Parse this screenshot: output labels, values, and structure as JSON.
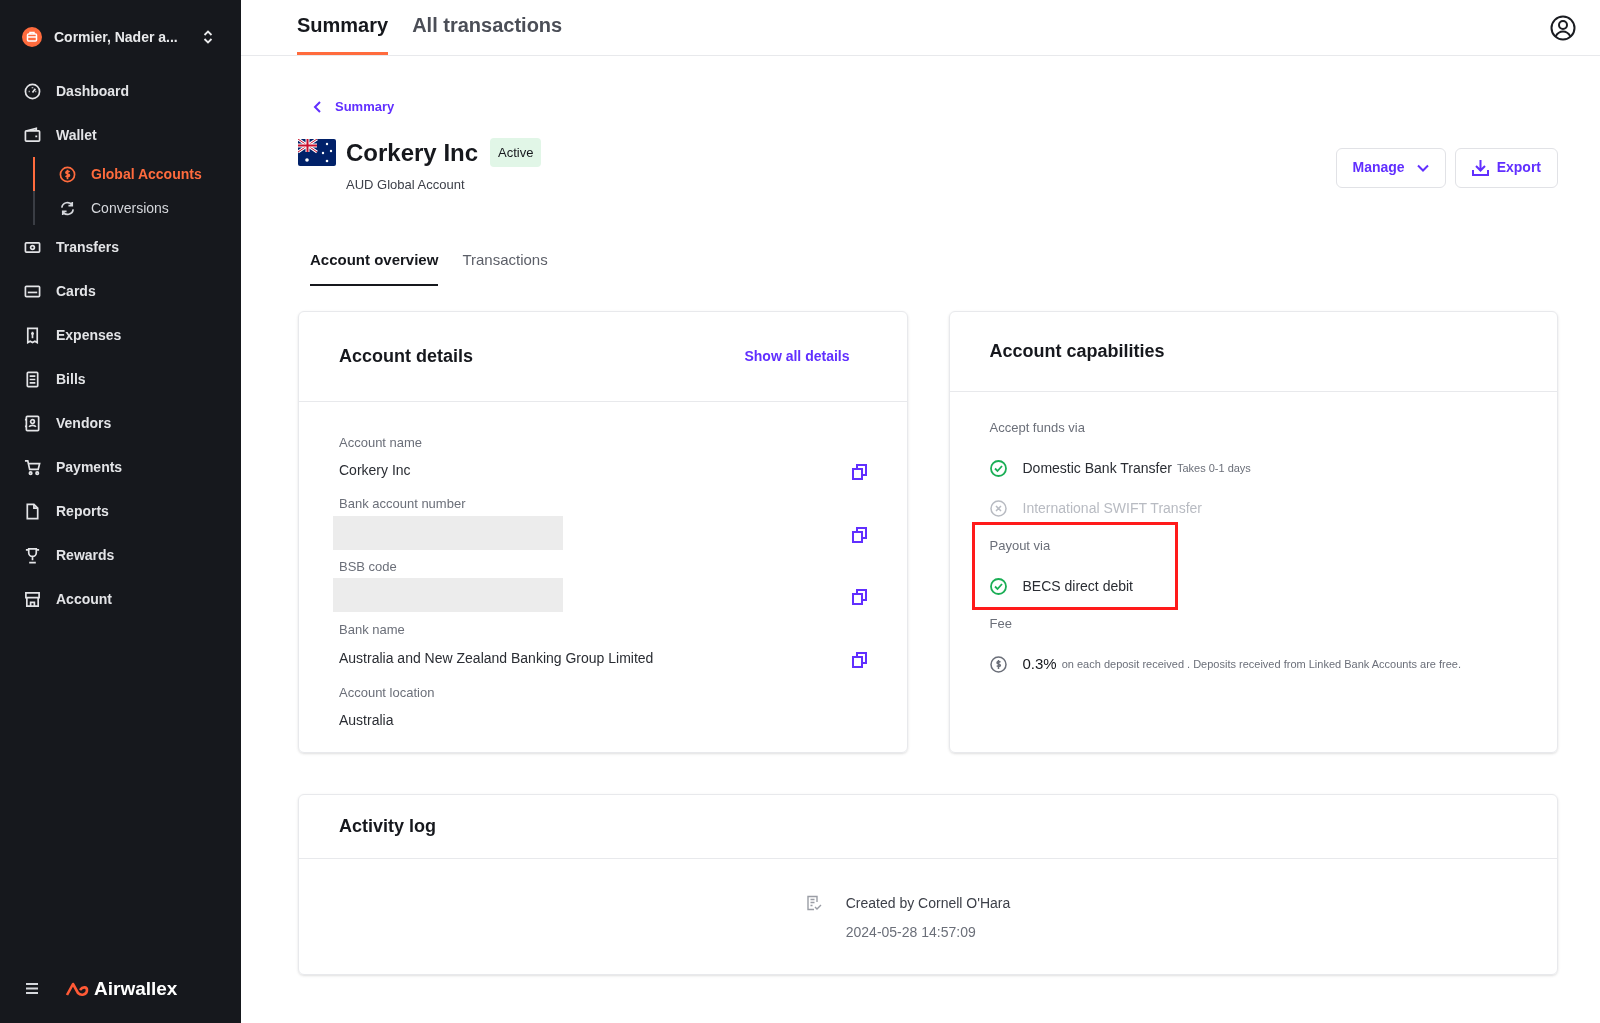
{
  "sidebar": {
    "org_name": "Cormier, Nader a...",
    "nav": [
      {
        "label": "Dashboard",
        "selected": false
      },
      {
        "label": "Wallet",
        "selected": false,
        "children": [
          {
            "label": "Global Accounts",
            "selected": true
          },
          {
            "label": "Conversions",
            "selected": false
          }
        ]
      },
      {
        "label": "Transfers",
        "selected": false
      },
      {
        "label": "Cards",
        "selected": false
      },
      {
        "label": "Expenses",
        "selected": false
      },
      {
        "label": "Bills",
        "selected": false
      },
      {
        "label": "Vendors",
        "selected": false
      },
      {
        "label": "Payments",
        "selected": false
      },
      {
        "label": "Reports",
        "selected": false
      },
      {
        "label": "Rewards",
        "selected": false
      },
      {
        "label": "Account",
        "selected": false
      }
    ],
    "brand": "Airwallex"
  },
  "top_tabs": [
    {
      "label": "Summary",
      "selected": true
    },
    {
      "label": "All transactions",
      "selected": false
    }
  ],
  "breadcrumb": "Summary",
  "account": {
    "name": "Corkery Inc",
    "status": "Active",
    "subtitle": "AUD Global Account"
  },
  "actions": [
    {
      "kind": "dropdown",
      "label": "Manage"
    },
    {
      "kind": "export",
      "label": "Export"
    }
  ],
  "tabs": [
    {
      "label": "Account overview",
      "selected": true
    },
    {
      "label": "Transactions",
      "selected": false
    }
  ],
  "account_details": {
    "title": "Account details",
    "link": "Show all details",
    "fields": [
      {
        "label": "Account name",
        "value": "Corkery Inc",
        "masked": false,
        "copyable": true
      },
      {
        "label": "Bank account number",
        "masked": true,
        "copyable": true
      },
      {
        "label": "BSB code",
        "masked": true,
        "copyable": true
      },
      {
        "label": "Bank name",
        "value": "Australia and New Zealand Banking Group Limited",
        "masked": false,
        "copyable": true
      },
      {
        "label": "Account location",
        "value": "Australia",
        "masked": false,
        "copyable": false
      }
    ]
  },
  "capabilities": {
    "title": "Account capabilities",
    "sections": [
      {
        "heading": "Accept funds via",
        "highlighted": false,
        "items": [
          {
            "kind": "method",
            "label": "Domestic Bank Transfer",
            "note": "Takes 0-1 days",
            "enabled": true
          },
          {
            "kind": "method",
            "label": "International SWIFT Transfer",
            "enabled": false
          }
        ]
      },
      {
        "heading": "Payout via",
        "highlighted": true,
        "items": [
          {
            "kind": "method",
            "label": "BECS direct debit",
            "enabled": true
          }
        ]
      },
      {
        "heading": "Fee",
        "highlighted": false,
        "items": [
          {
            "kind": "fee",
            "label": "0.3%",
            "note": "on each deposit received . Deposits received from Linked Bank Accounts are free."
          }
        ]
      }
    ]
  },
  "activity_log": {
    "title": "Activity log",
    "entries": [
      {
        "text": "Created by Cornell O'Hara",
        "time": "2024-05-28 14:57:09"
      }
    ]
  }
}
